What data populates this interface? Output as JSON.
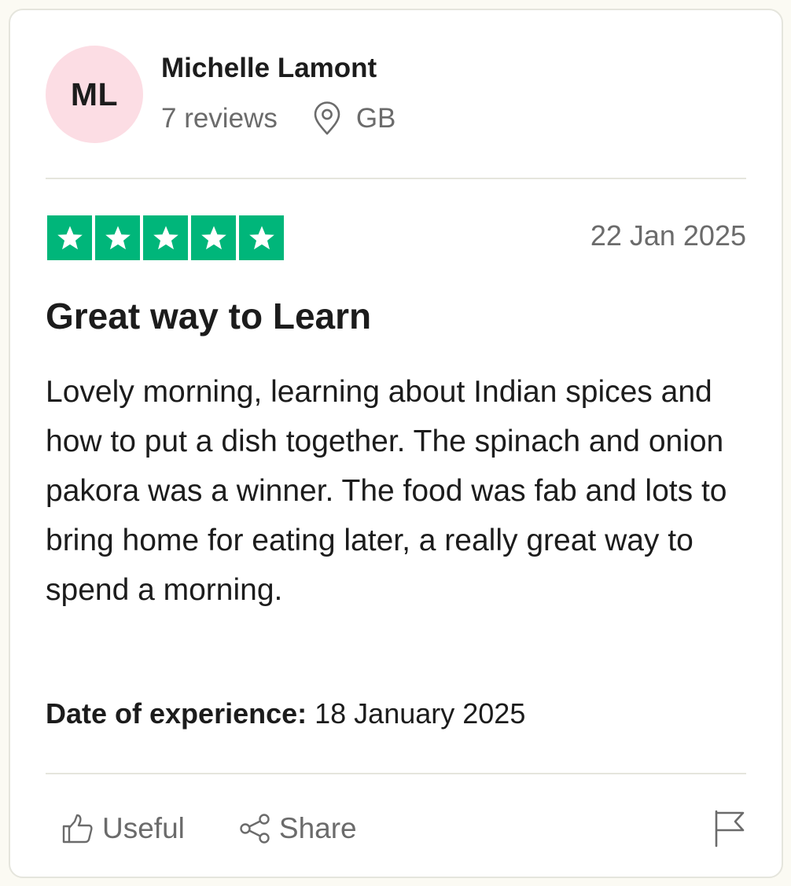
{
  "reviewer": {
    "initials": "ML",
    "name": "Michelle Lamont",
    "reviews_count": "7 reviews",
    "location": "GB",
    "avatar_color": "#fcdde4"
  },
  "rating": {
    "stars": 5,
    "max": 5,
    "color": "#00b67a"
  },
  "review": {
    "date": "22 Jan 2025",
    "title": "Great way to Learn",
    "body": "Lovely morning, learning about Indian spices and how to put a dish together. The spinach and onion pakora was a winner. The food was fab and lots to bring home for eating later, a really great way to spend a morning.",
    "experience_label": "Date of experience:",
    "experience_date": "18 January 2025"
  },
  "actions": {
    "useful_label": "Useful",
    "share_label": "Share",
    "useful_icon": "thumbs-up-icon",
    "share_icon": "share-icon",
    "report_icon": "flag-icon"
  }
}
